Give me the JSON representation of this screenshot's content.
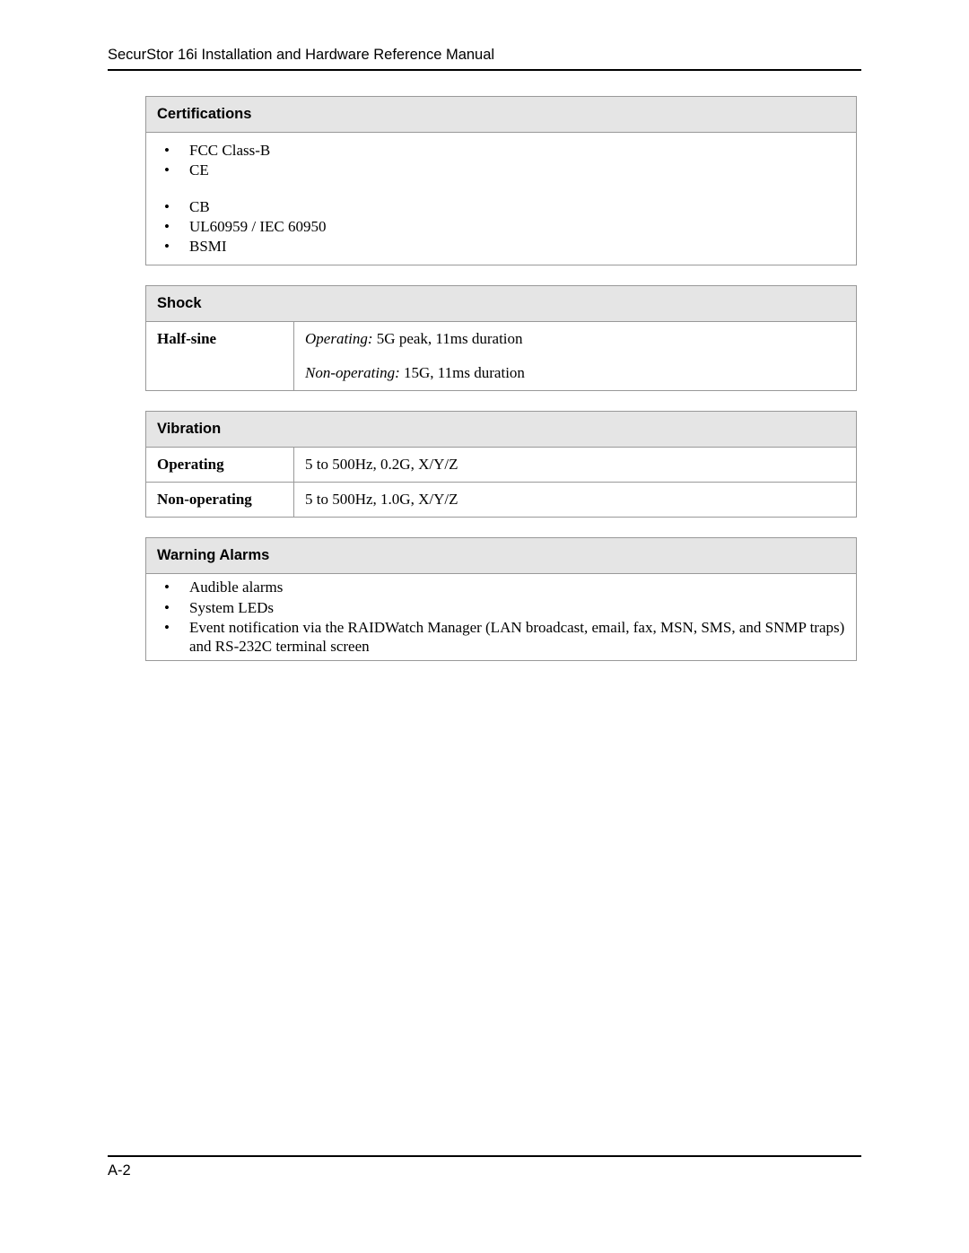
{
  "header": {
    "title": "SecurStor 16i Installation and Hardware Reference Manual"
  },
  "certifications": {
    "heading": "Certifications",
    "group1": [
      "FCC Class-B",
      "CE"
    ],
    "group2": [
      "CB",
      "UL60959 / IEC 60950",
      "BSMI"
    ]
  },
  "shock": {
    "heading": "Shock",
    "row_label": "Half-sine",
    "operating_label": "Operating:",
    "operating_value": " 5G peak, 11ms duration",
    "nonoperating_label": "Non-operating:",
    "nonoperating_value": " 15G, 11ms duration"
  },
  "vibration": {
    "heading": "Vibration",
    "operating_label": "Operating",
    "operating_value": "5 to 500Hz, 0.2G, X/Y/Z",
    "nonoperating_label": "Non-operating",
    "nonoperating_value": "5 to 500Hz, 1.0G, X/Y/Z"
  },
  "warning_alarms": {
    "heading": "Warning Alarms",
    "items": [
      "Audible alarms",
      "System LEDs",
      "Event notification via the RAIDWatch Manager (LAN broadcast, email, fax, MSN, SMS, and SNMP traps) and RS-232C terminal screen"
    ]
  },
  "footer": {
    "page_number": "A-2"
  }
}
